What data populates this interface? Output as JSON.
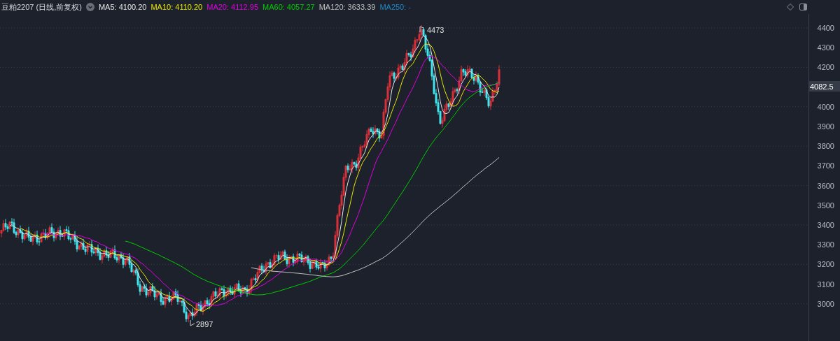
{
  "header": {
    "title": "豆粕2207 (日线,前复权)",
    "indicators": [
      {
        "label": "MA5:",
        "value": "4100.20",
        "color": "#e6e6e6"
      },
      {
        "label": "MA10:",
        "value": "4110.20",
        "color": "#e6e600"
      },
      {
        "label": "MA20:",
        "value": "4112.95",
        "color": "#e000e0"
      },
      {
        "label": "MA60:",
        "value": "4057.27",
        "color": "#00cc00"
      },
      {
        "label": "MA120:",
        "value": "3633.39",
        "color": "#c0c0c0"
      },
      {
        "label": "MA250:",
        "value": "-",
        "color": "#1e88c8"
      }
    ]
  },
  "y_axis": {
    "ticks": [
      "4400",
      "4300",
      "4200",
      "4000",
      "3900",
      "3800",
      "3700",
      "3600",
      "3500",
      "3400",
      "3300",
      "3200",
      "3100",
      "3000"
    ],
    "current_price": "4082.5"
  },
  "annotations": {
    "high": "4473",
    "low": "2897"
  }
}
